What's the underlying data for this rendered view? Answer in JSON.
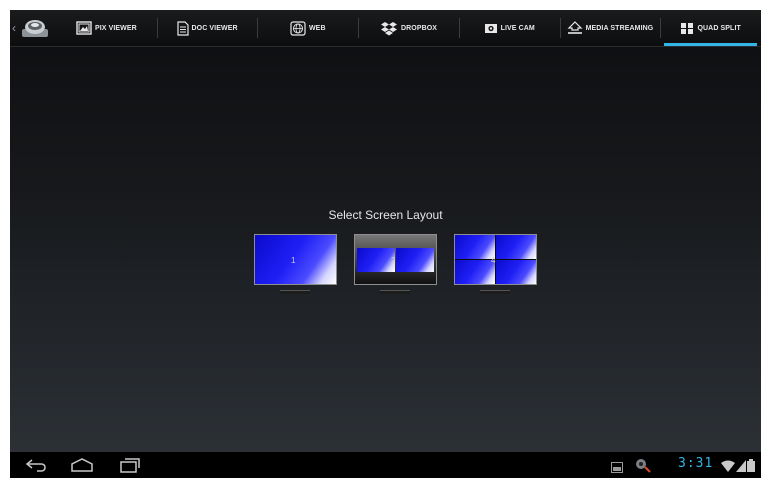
{
  "tabs": [
    {
      "label": "PIX VIEWER",
      "icon": "picture-icon"
    },
    {
      "label": "DOC VIEWER",
      "icon": "document-icon"
    },
    {
      "label": "WEB",
      "icon": "globe-icon"
    },
    {
      "label": "DROPBOX",
      "icon": "dropbox-icon"
    },
    {
      "label": "LIVE CAM",
      "icon": "camera-icon"
    },
    {
      "label": "MEDIA STREAMING",
      "icon": "streaming-icon"
    },
    {
      "label": "QUAD SPLIT",
      "icon": "quad-grid-icon"
    }
  ],
  "active_tab": "QUAD SPLIT",
  "main": {
    "prompt": "Select Screen Layout",
    "layouts": [
      {
        "label": "1"
      },
      {
        "label": "2"
      },
      {
        "label": "4"
      }
    ]
  },
  "status_bar": {
    "clock": "3:31"
  },
  "colors": {
    "accent": "#33b5e5",
    "pane_blue": "#1f1ff5"
  }
}
